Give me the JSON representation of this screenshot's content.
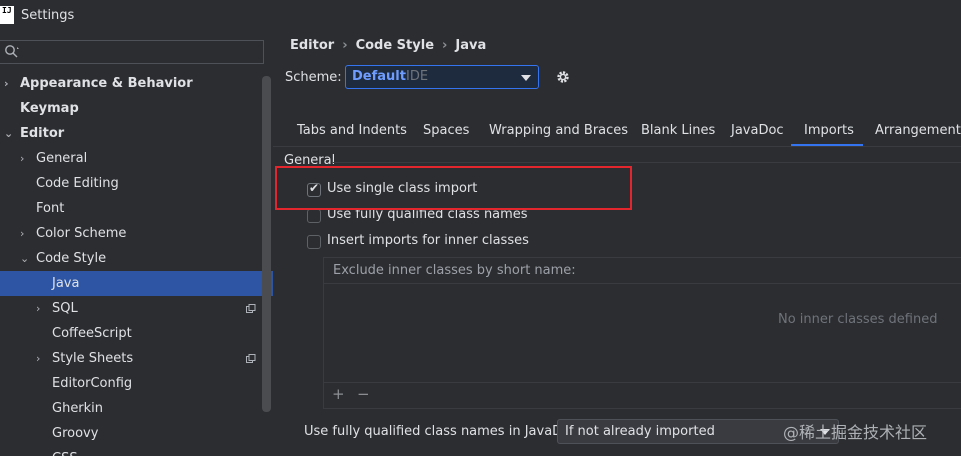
{
  "window": {
    "title": "Settings",
    "logo": "IJ"
  },
  "search": {
    "placeholder": ""
  },
  "sidebar": {
    "items": [
      {
        "label": "Appearance & Behavior",
        "bold": true,
        "chevron": "›"
      },
      {
        "label": "Keymap",
        "bold": true
      },
      {
        "label": "Editor",
        "bold": true,
        "chevron": "⌄"
      },
      {
        "label": "General",
        "chevron": "›"
      },
      {
        "label": "Code Editing"
      },
      {
        "label": "Font"
      },
      {
        "label": "Color Scheme",
        "chevron": "›"
      },
      {
        "label": "Code Style",
        "chevron": "⌄"
      },
      {
        "label": "Java",
        "selected": true
      },
      {
        "label": "SQL",
        "chevron": "›",
        "copy": true
      },
      {
        "label": "CoffeeScript"
      },
      {
        "label": "Style Sheets",
        "chevron": "›",
        "copy": true
      },
      {
        "label": "EditorConfig"
      },
      {
        "label": "Gherkin"
      },
      {
        "label": "Groovy"
      },
      {
        "label": "CSS"
      }
    ]
  },
  "breadcrumb": [
    "Editor",
    "Code Style",
    "Java"
  ],
  "breadcrumb_sep": "›",
  "scheme": {
    "label": "Scheme:",
    "value": "Default",
    "sub": "IDE"
  },
  "tabs": [
    "Tabs and Indents",
    "Spaces",
    "Wrapping and Braces",
    "Blank Lines",
    "JavaDoc",
    "Imports",
    "Arrangement"
  ],
  "active_tab": "Imports",
  "general": {
    "title": "General",
    "options": [
      {
        "label": "Use single class import",
        "checked": true
      },
      {
        "label": "Use fully qualified class names",
        "checked": false
      },
      {
        "label": "Insert imports for inner classes",
        "checked": false
      }
    ]
  },
  "exclude": {
    "header": "Exclude inner classes by short name:",
    "empty": "No inner classes defined",
    "add": "+",
    "remove": "−"
  },
  "javadoc": {
    "label": "Use fully qualified class names in JavaDoc:",
    "value": "If not already imported"
  },
  "watermark": "@稀土掘金技术社区",
  "colors": {
    "accent": "#3574f0",
    "selection": "#2e55a3",
    "highlight": "#e3262d",
    "bg": "#2b2d30"
  }
}
